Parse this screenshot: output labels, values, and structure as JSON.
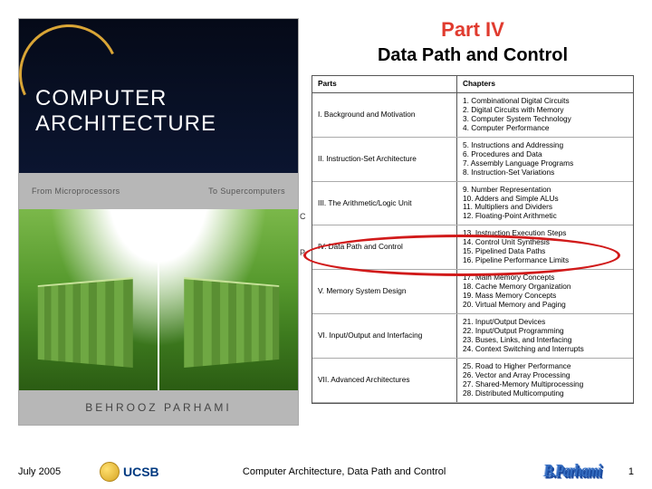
{
  "book_cover": {
    "title_line1": "COMPUTER",
    "title_line2": "ARCHITECTURE",
    "sub_left": "From Microprocessors",
    "sub_right": "To Supercomputers",
    "author": "BEHROOZ PARHAMI"
  },
  "heading": {
    "part": "Part IV",
    "subtitle": "Data Path and Control"
  },
  "toc": {
    "header_parts": "Parts",
    "header_chapters": "Chapters",
    "side_c": "C",
    "side_p": "P",
    "rows": [
      {
        "part": "I. Background and Motivation",
        "chaps": [
          "1. Combinational Digital Circuits",
          "2. Digital Circuits with Memory",
          "3. Computer System Technology",
          "4. Computer Performance"
        ]
      },
      {
        "part": "II. Instruction-Set Architecture",
        "chaps": [
          "5. Instructions and Addressing",
          "6. Procedures and Data",
          "7. Assembly Language Programs",
          "8. Instruction-Set Variations"
        ]
      },
      {
        "part": "III. The Arithmetic/Logic Unit",
        "chaps": [
          "9. Number Representation",
          "10. Adders and Simple ALUs",
          "11. Multipliers and Dividers",
          "12. Floating-Point Arithmetic"
        ]
      },
      {
        "part": "IV. Data Path and Control",
        "chaps": [
          "13. Instruction Execution Steps",
          "14. Control Unit Synthesis",
          "15. Pipelined Data Paths",
          "16. Pipeline Performance Limits"
        ]
      },
      {
        "part": "V. Memory System Design",
        "chaps": [
          "17. Main Memory Concepts",
          "18. Cache Memory Organization",
          "19. Mass Memory Concepts",
          "20. Virtual Memory and Paging"
        ]
      },
      {
        "part": "VI. Input/Output and Interfacing",
        "chaps": [
          "21. Input/Output Devices",
          "22. Input/Output Programming",
          "23. Buses, Links, and Interfacing",
          "24. Context Switching and Interrupts"
        ]
      },
      {
        "part": "VII. Advanced Architectures",
        "chaps": [
          "25. Road to Higher Performance",
          "26. Vector and Array Processing",
          "27. Shared-Memory Multiprocessing",
          "28. Distributed Multicomputing"
        ]
      }
    ]
  },
  "footer": {
    "date": "July 2005",
    "logo_text": "UCSB",
    "center": "Computer Architecture, Data Path and Control",
    "signature": "B.Parhami",
    "page": "1"
  }
}
